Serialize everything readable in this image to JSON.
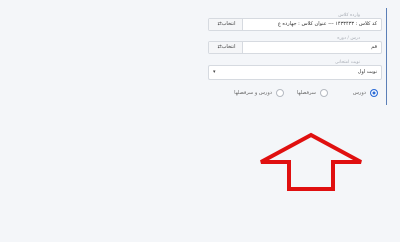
{
  "form": {
    "document": {
      "label": "وارده کلاس",
      "value": "کد کلاس : ۱۴۳۳۴۳۳ --- عنوان کلاس : جهارده ع",
      "pick_label": "انتخاب"
    },
    "lesson": {
      "label": "درس / دوره",
      "value": "قم",
      "pick_label": "انتخاب"
    },
    "term": {
      "label": "نوبت امتحانی",
      "selected": "نوبت اول"
    },
    "type_options": [
      {
        "label": "دورس",
        "checked": true
      },
      {
        "label": "سرفصلها",
        "checked": false
      },
      {
        "label": "دورس و سرفصلها",
        "checked": false
      }
    ]
  },
  "colors": {
    "accent": "#2b6bd6",
    "panel_border": "#5b7fb7",
    "arrow": "#e01010"
  }
}
